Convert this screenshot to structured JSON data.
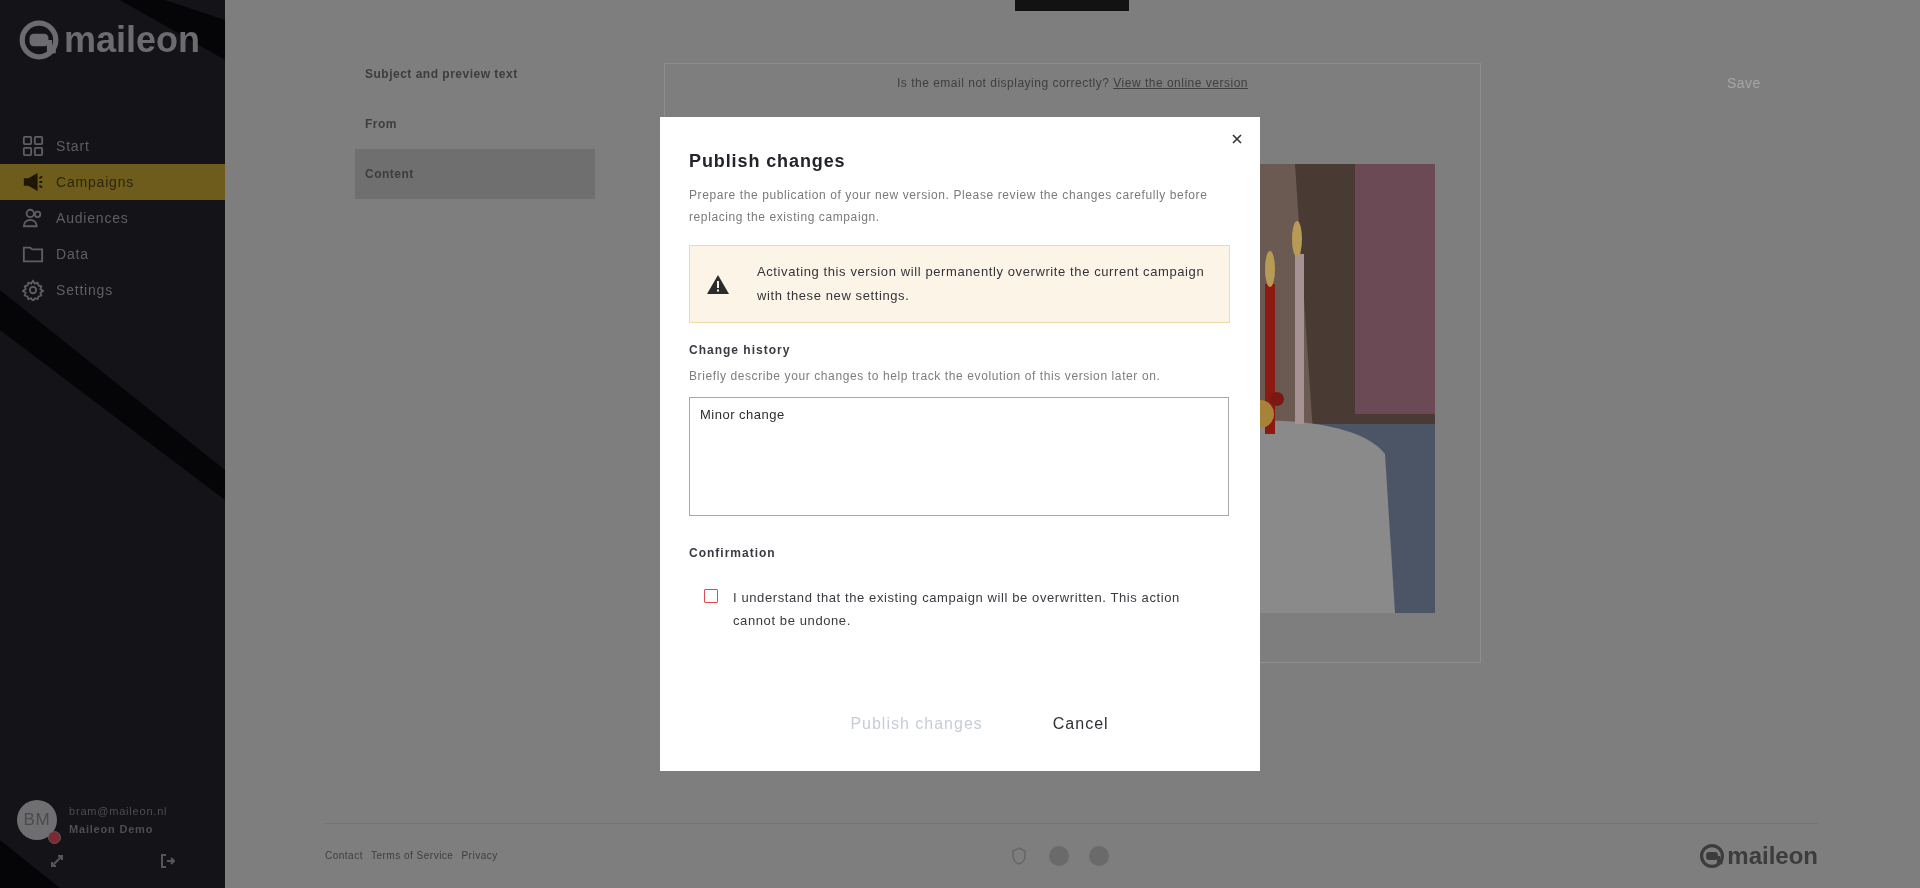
{
  "sidebar": {
    "logo": "maileon",
    "items": [
      {
        "label": "Start",
        "selected": false
      },
      {
        "label": "Campaigns",
        "selected": true
      },
      {
        "label": "Audiences",
        "selected": false
      },
      {
        "label": "Data",
        "selected": false
      },
      {
        "label": "Settings",
        "selected": false
      }
    ],
    "user": {
      "initials": "BM",
      "email": "bram@maileon.nl",
      "account": "Maileon Demo"
    }
  },
  "editor": {
    "sections": [
      {
        "label": "Subject and preview text",
        "selected": false
      },
      {
        "label": "From",
        "selected": false
      },
      {
        "label": "Content",
        "selected": true
      }
    ],
    "save_button": "Save",
    "preview": {
      "notice": "Is the email not displaying correctly?",
      "link": "View the online version"
    }
  },
  "footer": {
    "links": [
      "Contact",
      "Terms of Service",
      "Privacy"
    ],
    "logo": "maileon"
  },
  "dialog": {
    "title": "Publish changes",
    "description": "Prepare the publication of your new version. Please review the changes carefully before replacing the existing campaign.",
    "warning": "Activating this version will permanently overwrite the current campaign with these new settings.",
    "history_label": "Change history",
    "history_hint": "Briefly describe your changes to help track the evolution of this version later on.",
    "history_value": "Minor change",
    "confirmation_label": "Confirmation",
    "confirm": {
      "label": "I understand that the existing campaign will be overwritten. This action cannot be undone.",
      "checked": false
    },
    "buttons": [
      {
        "label": "Publish changes",
        "disabled": true
      },
      {
        "label": "Cancel",
        "disabled": false
      }
    ]
  }
}
